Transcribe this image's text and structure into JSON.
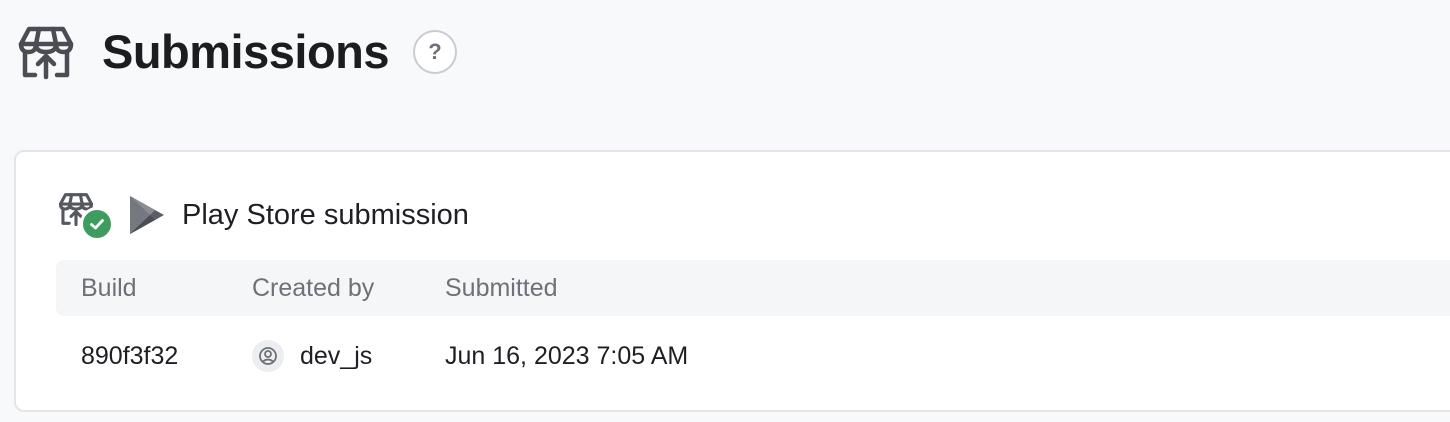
{
  "page": {
    "title": "Submissions",
    "help_label": "?",
    "icon": "store-upload-icon"
  },
  "submission": {
    "title": "Play Store submission",
    "status": "success",
    "status_color": "#3e9d5e",
    "platform_icon": "play-store-icon",
    "columns": [
      "Build",
      "Created by",
      "Submitted"
    ],
    "row": {
      "build": "890f3f32",
      "created_by": "dev_js",
      "submitted": "Jun 16, 2023 7:05 AM"
    }
  }
}
